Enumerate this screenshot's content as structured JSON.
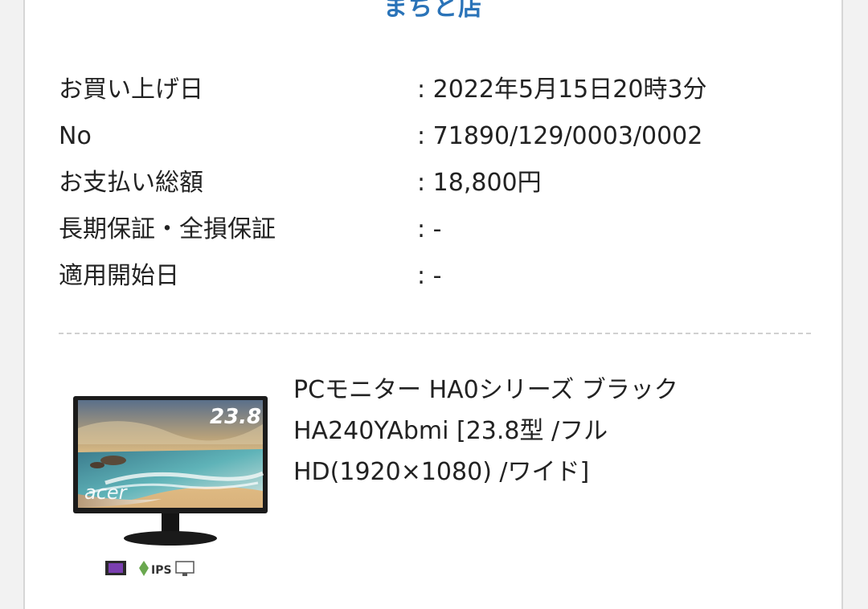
{
  "store": {
    "name": "まちと店"
  },
  "purchase_info": [
    {
      "label": "お買い上げ日",
      "value": ": 2022年5月15日20時3分"
    },
    {
      "label": "No",
      "value": ": 71890/129/0003/0002"
    },
    {
      "label": "お支払い総額",
      "value": ": 18,800円"
    },
    {
      "label": "長期保証・全損保証",
      "value": ": -"
    },
    {
      "label": "適用開始日",
      "value": ": -"
    }
  ],
  "product": {
    "name_lines": [
      "PCモニター HA0シリーズ ブラック",
      "HA240YAbmi [23.8型 /フル",
      "HD(1920×1080) /ワイド]"
    ],
    "image": {
      "screen_size_badge": "23.8",
      "brand": "acer",
      "feature_badges": [
        "IPS"
      ]
    }
  }
}
